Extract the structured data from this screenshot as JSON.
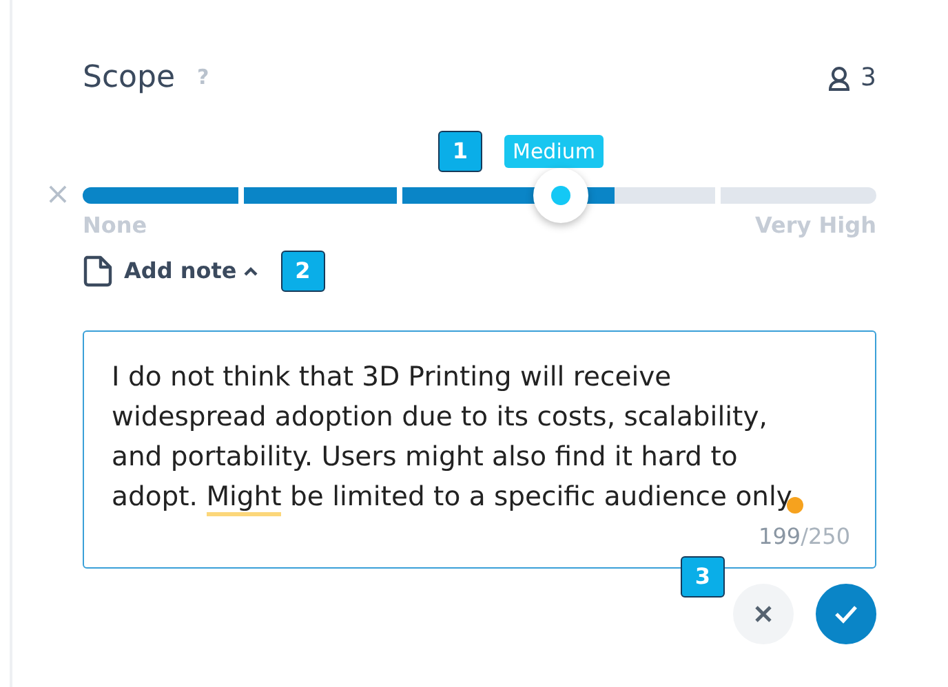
{
  "header": {
    "title": "Scope",
    "help": "?",
    "participants": "3"
  },
  "slider": {
    "value_label": "Medium",
    "level": 0.67,
    "clear": "×",
    "min_label": "None",
    "max_label": "Very High"
  },
  "note_toggle": {
    "label": "Add note",
    "expanded": true
  },
  "note": {
    "segments": [
      {
        "text": "I do not think that 3D Printing will receive widespread adoption due to its costs, scalability, and portability. Users might also find it hard to adopt. ",
        "flagged": false
      },
      {
        "text": "Might",
        "flagged": true
      },
      {
        "text": " be limited to a specific audience only",
        "flagged": false
      }
    ],
    "count": "199",
    "limit": "/250"
  },
  "markers": [
    "1",
    "2",
    "3"
  ]
}
